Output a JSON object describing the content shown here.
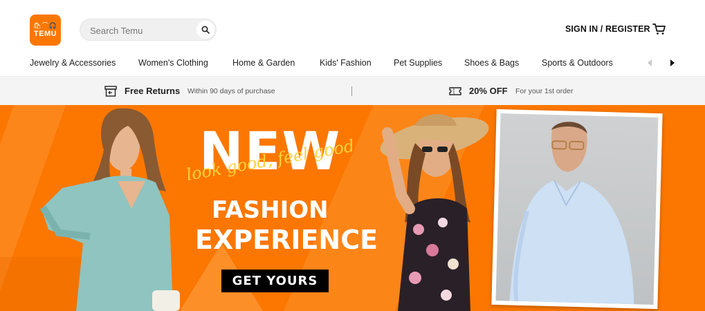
{
  "header": {
    "logo": {
      "glyphs": "🛍⌒🎧",
      "word": "TEMU",
      "color": "#fb7701"
    },
    "search": {
      "placeholder": "Search Temu",
      "icon": "search-icon"
    },
    "signin_label": "SIGN IN / REGISTER",
    "cart_icon": "cart-icon"
  },
  "categories": [
    "Jewelry & Accessories",
    "Women's Clothing",
    "Home & Garden",
    "Kids' Fashion",
    "Pet Supplies",
    "Shoes & Bags",
    "Sports & Outdoors"
  ],
  "promo": {
    "returns": {
      "title": "Free Returns",
      "sub": "Within 90 days of purchase",
      "icon": "return-box-icon"
    },
    "discount": {
      "title": "20% OFF",
      "sub": "For your 1st order",
      "icon": "coupon-icon"
    }
  },
  "banner": {
    "headline": "NEW",
    "script": "look good, feel good",
    "line2": "FASHION",
    "line3": "EXPERIENCE",
    "cta_label": "GET YOURS",
    "accent": "#fb7701",
    "script_color": "#ffd23a"
  }
}
